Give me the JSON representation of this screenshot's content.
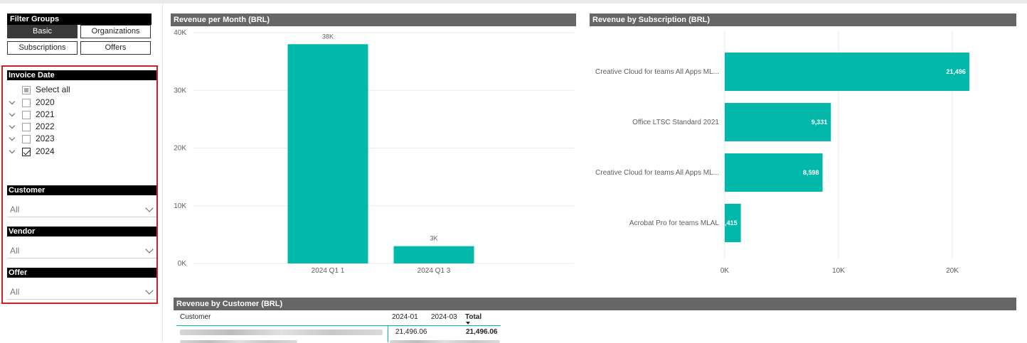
{
  "filter_groups": {
    "title": "Filter Groups",
    "buttons": [
      "Basic",
      "Organizations",
      "Subscriptions",
      "Offers"
    ],
    "active": "Basic"
  },
  "invoice_date": {
    "title": "Invoice Date",
    "select_all": "Select all",
    "years": [
      "2020",
      "2021",
      "2022",
      "2023",
      "2024"
    ],
    "checked": "2024"
  },
  "customer": {
    "title": "Customer",
    "value": "All"
  },
  "vendor": {
    "title": "Vendor",
    "value": "All"
  },
  "offer": {
    "title": "Offer",
    "value": "All"
  },
  "revenue_month": {
    "title": "Revenue per Month (BRL)",
    "chart_data": {
      "type": "bar",
      "categories": [
        "2024 Q1 1",
        "2024 Q1 3"
      ],
      "values": [
        38000,
        3000
      ],
      "data_labels": [
        "38K",
        "3K"
      ],
      "y_ticks": [
        "0K",
        "10K",
        "20K",
        "30K",
        "40K"
      ],
      "ylim": [
        0,
        40000
      ],
      "color": "#01b8aa"
    }
  },
  "revenue_subscription": {
    "title": "Revenue by Subscription (BRL)",
    "chart_data": {
      "type": "bar",
      "orientation": "horizontal",
      "categories": [
        "Creative Cloud for teams All Apps ML...",
        "Office LTSC Standard 2021",
        "Creative Cloud for teams All Apps ML...",
        "Acrobat Pro for teams MLAL"
      ],
      "values": [
        21496,
        9331,
        8598,
        1415
      ],
      "data_labels": [
        "21,496",
        "9,331",
        "8,598",
        "1,415"
      ],
      "x_ticks": [
        "0K",
        "10K",
        "20K"
      ],
      "xlim": [
        0,
        25000
      ],
      "color": "#01b8aa"
    }
  },
  "revenue_customer": {
    "title": "Revenue by Customer (BRL)",
    "columns": [
      "Customer",
      "2024-01",
      "2024-03",
      "Total"
    ],
    "row1": {
      "c2024_01": "21,496.06",
      "total": "21,496.06"
    }
  }
}
